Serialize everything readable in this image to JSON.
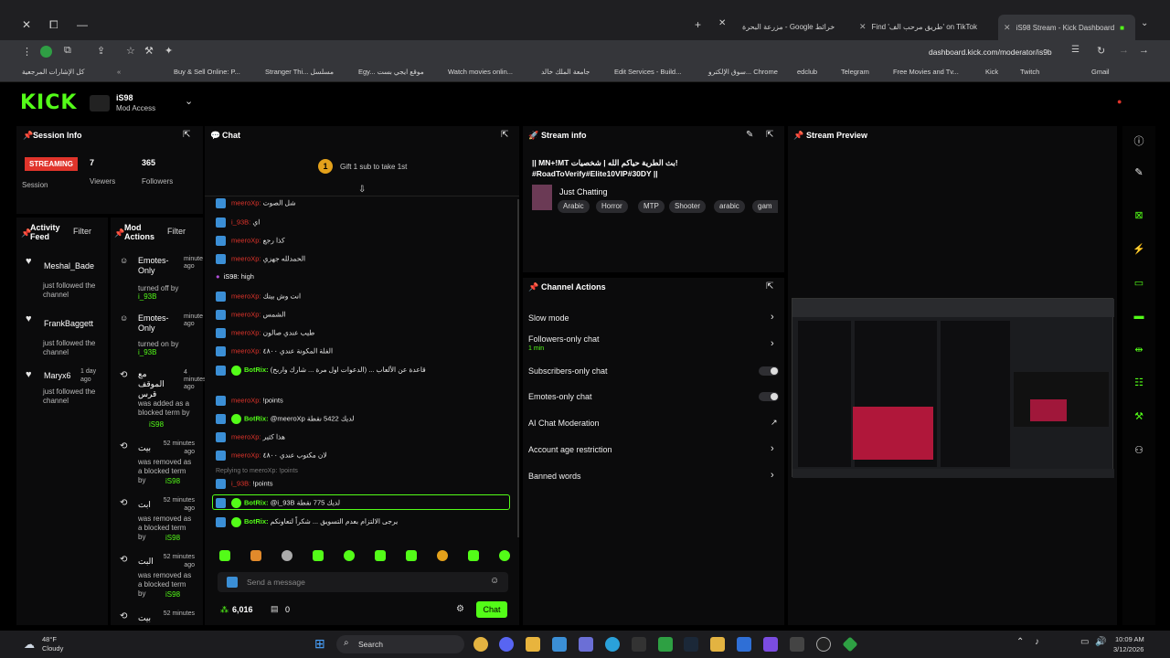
{
  "browser": {
    "tabs": [
      {
        "label": "مزرعة البحرة - Google خرائط"
      },
      {
        "label": "Find 'طريق مرحب الف' on TikTok"
      },
      {
        "label": "iS98 Stream - Kick Dashboard"
      }
    ],
    "address": "dashboard.kick.com/moderator/is9b",
    "bookmarks": [
      "كل الإشارات المرجعية",
      "Buy & Sell Online: P...",
      "Stranger Thi... مسلسل",
      "Egy... موقع ايجي بست",
      "Watch movies onlin...",
      "جامعة الملك خالد",
      "Edit Services - Build...",
      "سوق الإلكترو... Chrome",
      "edclub",
      "Telegram",
      "Free Movies and Tv...",
      "Kick",
      "Twitch",
      "Gmail"
    ]
  },
  "header": {
    "logo": "KICK",
    "channel": "iS98",
    "access": "Mod Access"
  },
  "session": {
    "title": "Session Info",
    "status": "STREAMING",
    "viewers": "7",
    "viewers_label": "Viewers",
    "followers": "365",
    "followers_label": "Followers",
    "session_label": "Session"
  },
  "activity": {
    "title": "Activity Feed",
    "filter": "Filter",
    "items": [
      {
        "name": "Meshal_Bade",
        "text": "just followed the channel"
      },
      {
        "name": "FrankBaggett",
        "text": "just followed the channel"
      },
      {
        "name": "Maryx6",
        "text": "just followed the channel",
        "time": "1 day ago"
      }
    ]
  },
  "modactions": {
    "title": "Mod Actions",
    "filter": "Filter",
    "items": [
      {
        "title": "Emotes-Only",
        "text": "turned off by",
        "by": "i_93B",
        "time": "minute ago"
      },
      {
        "title": "Emotes-Only",
        "text": "turned on by",
        "by": "i_93B",
        "time": "minute ago"
      },
      {
        "title": "مع الموقف قرس",
        "text": "was added as a blocked term by",
        "by": "iS98",
        "time": "4 minutes ago"
      },
      {
        "title": "بيت",
        "text": "was removed as a blocked term by",
        "by": "iS98",
        "time": "52 minutes ago"
      },
      {
        "title": "ابت",
        "text": "was removed as a blocked term by",
        "by": "iS98",
        "time": "52 minutes ago"
      },
      {
        "title": "البت",
        "text": "was removed as a blocked term by",
        "by": "iS98",
        "time": "52 minutes ago"
      },
      {
        "title": "بيت",
        "text": "",
        "by": "",
        "time": "52 minutes"
      }
    ]
  },
  "chat": {
    "title": "Chat",
    "gift_banner": "Gift 1 sub to take 1st",
    "messages": [
      {
        "user": "meeroXp:",
        "text": "شل الصوت",
        "cls": "red"
      },
      {
        "user": "i_93B:",
        "text": "اي",
        "cls": "red"
      },
      {
        "user": "meeroXp:",
        "text": "كذا رجع",
        "cls": "red"
      },
      {
        "user": "meeroXp:",
        "text": "الحمدلله جهزي",
        "cls": "red"
      },
      {
        "user": "iS98:",
        "text": "high",
        "cls": "white"
      },
      {
        "user": "meeroXp:",
        "text": "انت وش بيتك",
        "cls": "red"
      },
      {
        "user": "meeroXp:",
        "text": "الشمس",
        "cls": "red"
      },
      {
        "user": "meeroXp:",
        "text": "طيب عندي صالون",
        "cls": "red"
      },
      {
        "user": "meeroXp:",
        "text": "الفلة المكونة عندي ٤٨٠٠",
        "cls": "red"
      },
      {
        "user": "BotRix:",
        "text": "(الدعوات اول مرة ... شارك واربح) ... قاعدة عن الألعاب",
        "cls": "bot"
      },
      {
        "user": "meeroXp:",
        "text": "!points",
        "cls": "red"
      },
      {
        "user": "BotRix:",
        "text": "@meeroXp لديك 5422 نقطة",
        "cls": "bot"
      },
      {
        "user": "meeroXp:",
        "text": "هذا كثير",
        "cls": "red"
      },
      {
        "user": "meeroXp:",
        "text": "لان مكتوب عندي ٤٨٠٠",
        "cls": "red"
      },
      {
        "user": "Replying to meeroXp:",
        "text": "!points",
        "cls": "reply"
      },
      {
        "user": "i_93B:",
        "text": "!points",
        "cls": "red"
      },
      {
        "user": "BotRix:",
        "text": "@i_93B لديك 775 نقطة",
        "cls": "bot"
      },
      {
        "user": "BotRix:",
        "text": "يرجى الالتزام بعدم التسويق ... شكراً لتعاونكم",
        "cls": "bot"
      }
    ],
    "input_placeholder": "Send a message",
    "points": "6,016",
    "count": "0",
    "send": "Chat"
  },
  "streaminfo": {
    "title": "Stream info",
    "stream_title": "|| MN+!MT بث الطرية حياكم الله | شخصيات! #RoadToVerify#Elite10VIP#30DY ||",
    "category": "Just Chatting",
    "tags": [
      "Arabic",
      "Horror",
      "MTP",
      "Shooter",
      "arabic",
      "gam"
    ]
  },
  "channelactions": {
    "title": "Channel Actions",
    "items": [
      {
        "label": "Slow mode",
        "kind": "chevron"
      },
      {
        "label": "Followers-only chat",
        "sub": "1 min",
        "kind": "chevron"
      },
      {
        "label": "Subscribers-only chat",
        "kind": "toggle"
      },
      {
        "label": "Emotes-only chat",
        "kind": "toggle"
      },
      {
        "label": "AI Chat Moderation",
        "kind": "external"
      },
      {
        "label": "Account age restriction",
        "kind": "chevron"
      },
      {
        "label": "Banned words",
        "kind": "chevron"
      }
    ]
  },
  "preview": {
    "title": "Stream Preview"
  },
  "taskbar": {
    "weather_temp": "48°F",
    "weather_desc": "Cloudy",
    "search": "Search",
    "time": "10:09 AM",
    "date": "3/12/2026"
  },
  "colors": {
    "accent": "#53fc18",
    "live": "#e0342b"
  }
}
